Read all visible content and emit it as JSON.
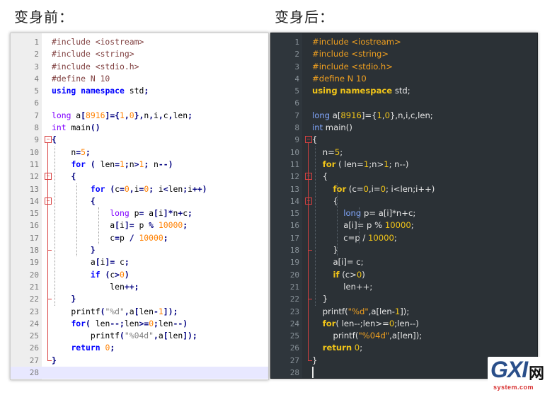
{
  "captions": {
    "before": "变身前：",
    "after": "变身后："
  },
  "code_lines": [
    "#include <iostream>",
    "#include <string>",
    "#include <stdio.h>",
    "#define N 10",
    "using namespace std;",
    "",
    "long a[8916]={1,0},n,i,c,len;",
    "int main()",
    "{",
    "    n=5;",
    "    for ( len=1;n>1; n--)",
    "    {",
    "        for (c=0,i=0; i<len;i++)",
    "        {",
    "            long p= a[i]*n+c;",
    "            a[i]= p % 10000;",
    "            c=p / 10000;",
    "        }",
    "        a[i]= c;",
    "        if (c>0)",
    "            len++;",
    "    }",
    "    printf(\"%d\",a[len-1]);",
    "    for( len--;len>=0;len--)",
    "        printf(\"%04d\",a[len]);",
    "    return 0;",
    "}",
    ""
  ],
  "line_numbers": [
    "1",
    "2",
    "3",
    "4",
    "5",
    "6",
    "7",
    "8",
    "9",
    "10",
    "11",
    "12",
    "13",
    "14",
    "15",
    "16",
    "17",
    "18",
    "19",
    "20",
    "21",
    "22",
    "23",
    "24",
    "25",
    "26",
    "27",
    "28"
  ],
  "watermark": {
    "logo": "GXI",
    "cn": "网",
    "domain": "system.com"
  },
  "colors": {
    "light_bg": "#ffffff",
    "dark_bg": "#2b3136",
    "fold_marker": "#d84040",
    "dark_keyword": "#f0c419",
    "light_keyword": "#0000ff"
  }
}
